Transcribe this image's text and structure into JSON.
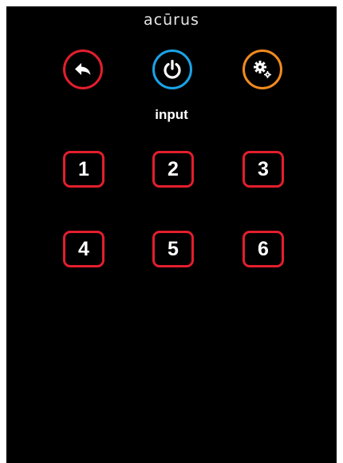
{
  "brand": {
    "name": "acūrus"
  },
  "top_controls": [
    {
      "icon": "back-arrow-icon",
      "color": "#e31e2d"
    },
    {
      "icon": "power-icon",
      "color": "#1aa3e8"
    },
    {
      "icon": "settings-gears-icon",
      "color": "#f08a1f"
    }
  ],
  "section": {
    "label": "input"
  },
  "inputs": [
    {
      "label": "1"
    },
    {
      "label": "2"
    },
    {
      "label": "3"
    },
    {
      "label": "4"
    },
    {
      "label": "5"
    },
    {
      "label": "6"
    }
  ],
  "colors": {
    "background": "#000000",
    "input_border": "#e31e2d",
    "text": "#ffffff"
  }
}
